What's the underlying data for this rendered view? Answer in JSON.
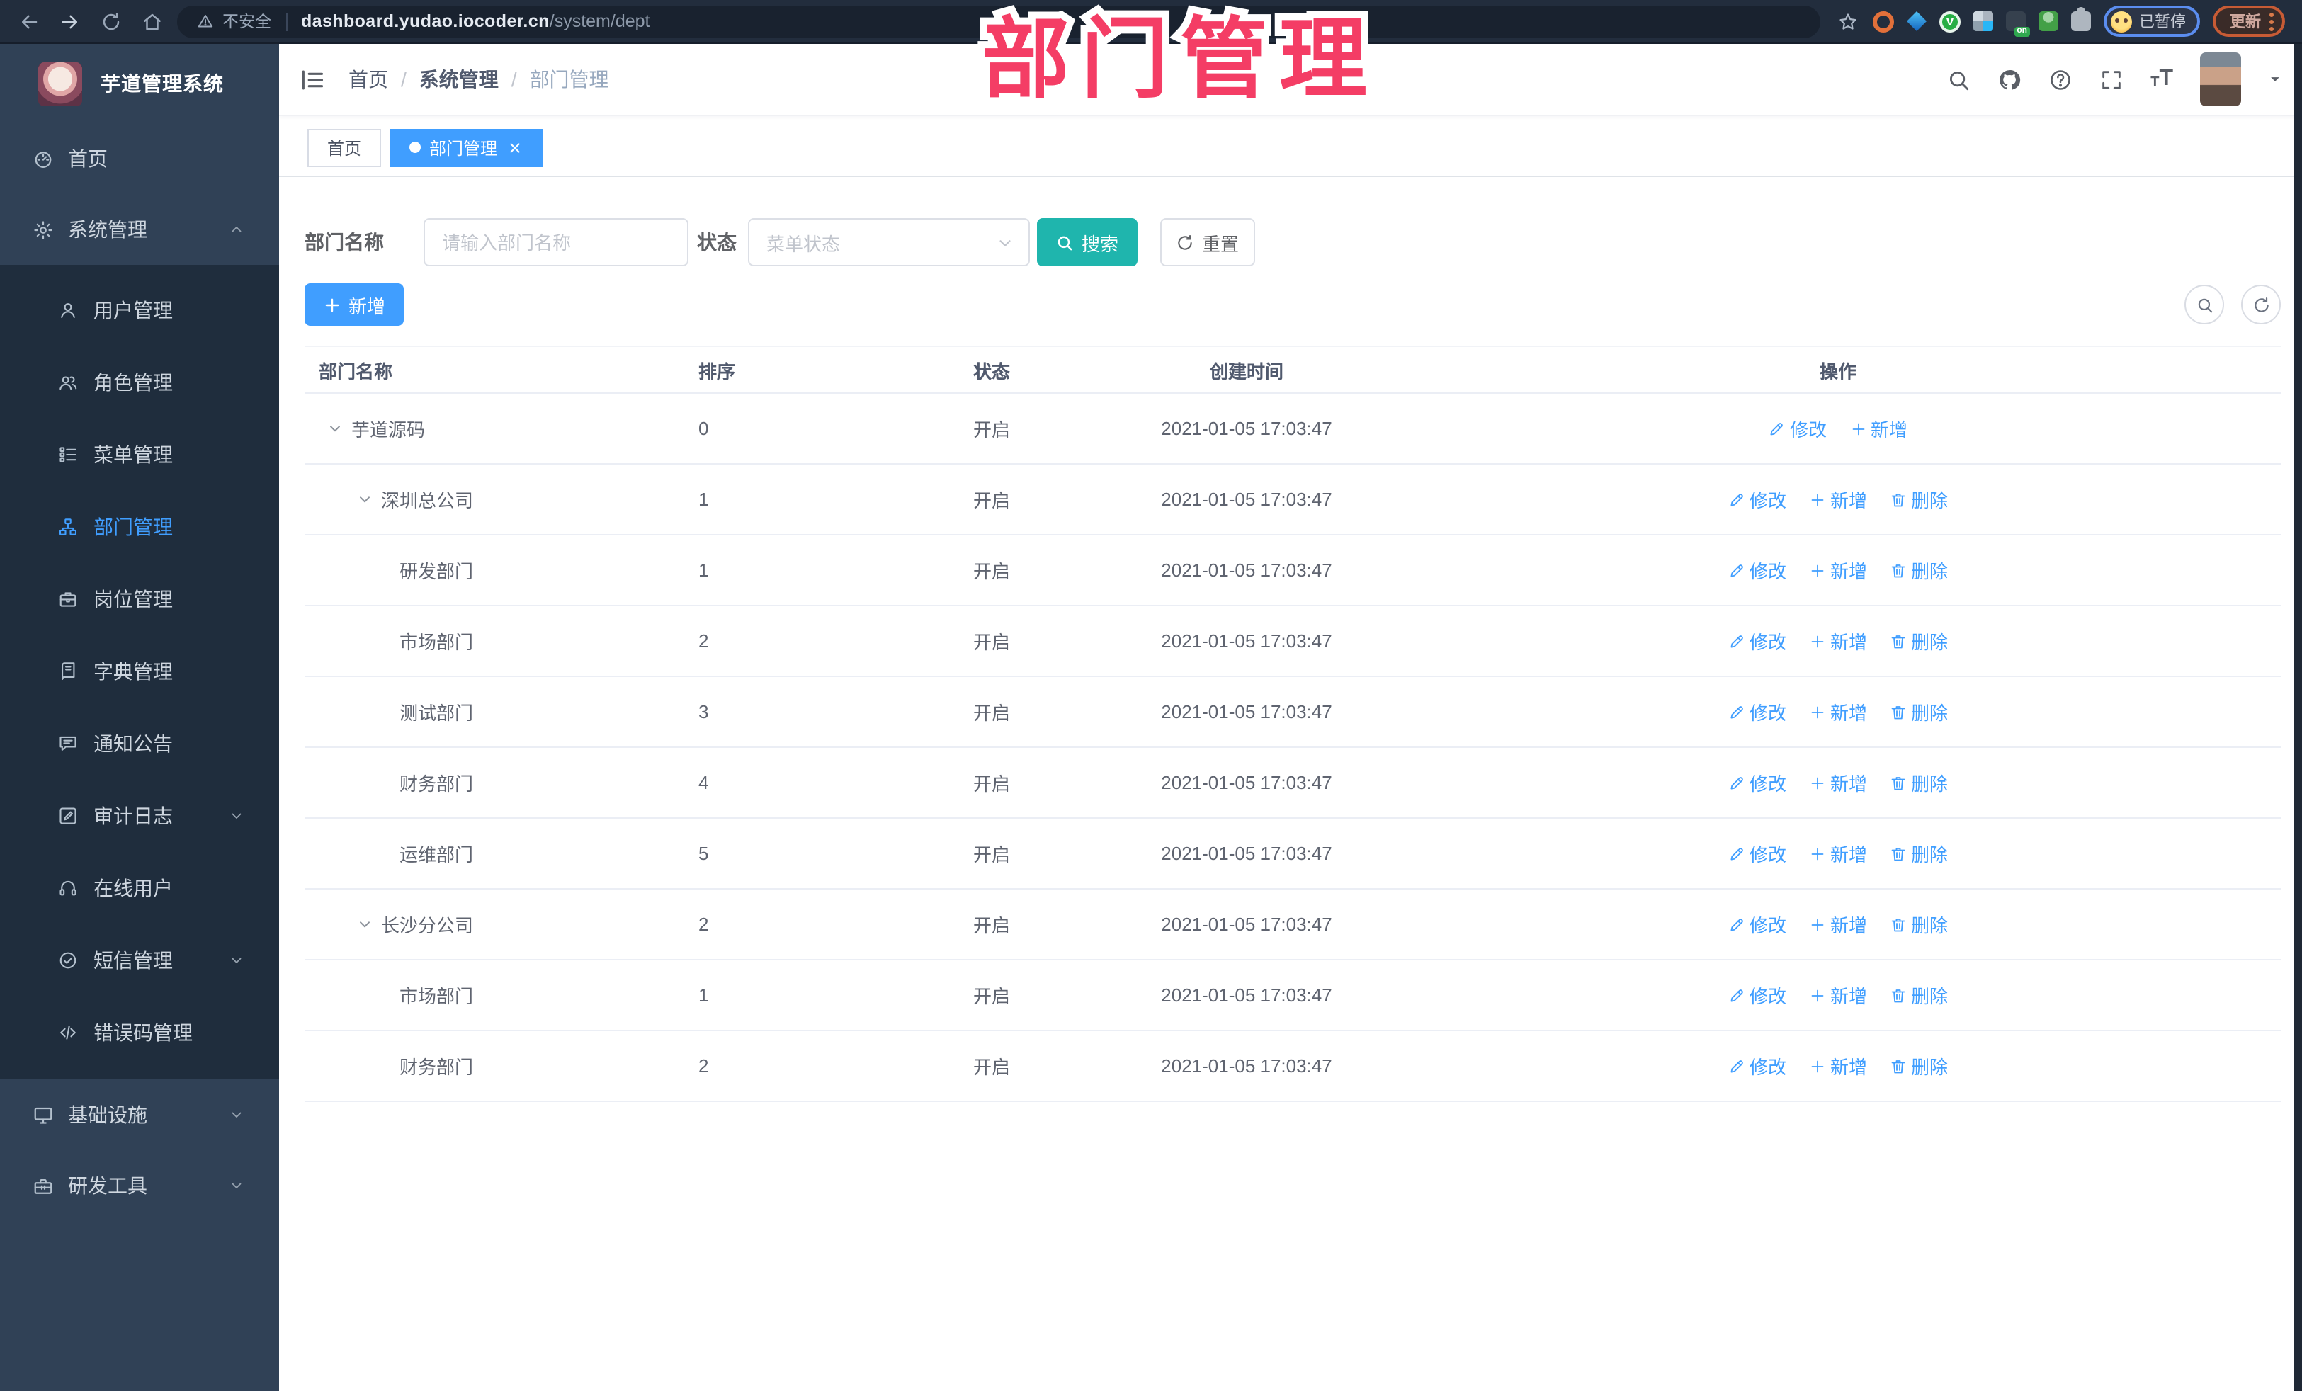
{
  "colors": {
    "accent": "#409EFF",
    "sidebar_bg": "#304156",
    "submenu_bg": "#1f2d3d",
    "search_button": "#1FB5AD",
    "overlay_pink": "#F43D65",
    "toolbar_bg": "#222d3d"
  },
  "browser": {
    "security_label": "不安全",
    "url_host": "dashboard.yudao.iocoder.cn",
    "url_path": "/system/dept",
    "profile_status": "已暂停",
    "update_label": "更新",
    "nav_icons": [
      "back-icon",
      "forward-icon",
      "reload-icon",
      "home-icon"
    ],
    "extension_icons": [
      "bookmark-star-icon",
      "ext-orange-icon",
      "ext-blue-icon",
      "ext-green-icon",
      "ext-grid-icon",
      "ext-onoff-icon",
      "ext-person-icon",
      "extensions-puzzle-icon"
    ]
  },
  "overlay": {
    "title": "部门管理"
  },
  "sidebar": {
    "logo_title": "芋道管理系统",
    "items": [
      {
        "key": "home",
        "label": "首页",
        "icon": "dashboard-icon",
        "level": 0
      },
      {
        "key": "system",
        "label": "系统管理",
        "icon": "gear-icon",
        "level": 0,
        "chevron": "up",
        "expanded": true
      },
      {
        "key": "user",
        "label": "用户管理",
        "icon": "user-icon",
        "level": 1
      },
      {
        "key": "role",
        "label": "角色管理",
        "icon": "roles-icon",
        "level": 1
      },
      {
        "key": "menu",
        "label": "菜单管理",
        "icon": "menu-tree-icon",
        "level": 1
      },
      {
        "key": "dept",
        "label": "部门管理",
        "icon": "org-chart-icon",
        "level": 1,
        "active": true
      },
      {
        "key": "post",
        "label": "岗位管理",
        "icon": "post-badge-icon",
        "level": 1
      },
      {
        "key": "dict",
        "label": "字典管理",
        "icon": "dictionary-icon",
        "level": 1
      },
      {
        "key": "notice",
        "label": "通知公告",
        "icon": "announcement-icon",
        "level": 1
      },
      {
        "key": "audit-log",
        "label": "审计日志",
        "icon": "audit-log-icon",
        "level": 1,
        "chevron": "down"
      },
      {
        "key": "online-user",
        "label": "在线用户",
        "icon": "online-users-icon",
        "level": 1
      },
      {
        "key": "sms",
        "label": "短信管理",
        "icon": "sms-icon",
        "level": 1,
        "chevron": "down"
      },
      {
        "key": "error-code",
        "label": "错误码管理",
        "icon": "error-code-icon",
        "level": 1
      },
      {
        "key": "infra",
        "label": "基础设施",
        "icon": "infrastructure-icon",
        "level": 0,
        "chevron": "down"
      },
      {
        "key": "dev-tools",
        "label": "研发工具",
        "icon": "dev-tools-icon",
        "level": 0,
        "chevron": "down"
      }
    ]
  },
  "header": {
    "breadcrumb": [
      "首页",
      "系统管理",
      "部门管理"
    ],
    "right_icons": [
      "search-icon",
      "github-icon",
      "help-icon",
      "fullscreen-icon",
      "font-size-icon",
      "avatar",
      "caret-down-icon"
    ]
  },
  "tabs": [
    {
      "label": "首页",
      "active": false
    },
    {
      "label": "部门管理",
      "active": true,
      "closable": true
    }
  ],
  "filters": {
    "name_label": "部门名称",
    "name_placeholder": "请输入部门名称",
    "name_value": "",
    "status_label": "状态",
    "status_placeholder": "菜单状态",
    "search_label": "搜索",
    "reset_label": "重置"
  },
  "toolbar": {
    "add_label": "新增"
  },
  "table": {
    "columns": [
      "部门名称",
      "排序",
      "状态",
      "创建时间",
      "操作"
    ],
    "action_defs": {
      "edit": {
        "label": "修改",
        "icon": "edit-icon"
      },
      "add": {
        "label": "新增",
        "icon": "plus-icon"
      },
      "delete": {
        "label": "删除",
        "icon": "delete-icon"
      }
    },
    "rows": [
      {
        "name": "芋道源码",
        "level": 0,
        "expandable": true,
        "order": "0",
        "status": "开启",
        "created": "2021-01-05 17:03:47",
        "actions": [
          "edit",
          "add"
        ]
      },
      {
        "name": "深圳总公司",
        "level": 1,
        "expandable": true,
        "order": "1",
        "status": "开启",
        "created": "2021-01-05 17:03:47",
        "actions": [
          "edit",
          "add",
          "delete"
        ]
      },
      {
        "name": "研发部门",
        "level": 2,
        "expandable": false,
        "order": "1",
        "status": "开启",
        "created": "2021-01-05 17:03:47",
        "actions": [
          "edit",
          "add",
          "delete"
        ]
      },
      {
        "name": "市场部门",
        "level": 2,
        "expandable": false,
        "order": "2",
        "status": "开启",
        "created": "2021-01-05 17:03:47",
        "actions": [
          "edit",
          "add",
          "delete"
        ]
      },
      {
        "name": "测试部门",
        "level": 2,
        "expandable": false,
        "order": "3",
        "status": "开启",
        "created": "2021-01-05 17:03:47",
        "actions": [
          "edit",
          "add",
          "delete"
        ]
      },
      {
        "name": "财务部门",
        "level": 2,
        "expandable": false,
        "order": "4",
        "status": "开启",
        "created": "2021-01-05 17:03:47",
        "actions": [
          "edit",
          "add",
          "delete"
        ]
      },
      {
        "name": "运维部门",
        "level": 2,
        "expandable": false,
        "order": "5",
        "status": "开启",
        "created": "2021-01-05 17:03:47",
        "actions": [
          "edit",
          "add",
          "delete"
        ]
      },
      {
        "name": "长沙分公司",
        "level": 1,
        "expandable": true,
        "order": "2",
        "status": "开启",
        "created": "2021-01-05 17:03:47",
        "actions": [
          "edit",
          "add",
          "delete"
        ]
      },
      {
        "name": "市场部门",
        "level": 2,
        "expandable": false,
        "order": "1",
        "status": "开启",
        "created": "2021-01-05 17:03:47",
        "actions": [
          "edit",
          "add",
          "delete"
        ]
      },
      {
        "name": "财务部门",
        "level": 2,
        "expandable": false,
        "order": "2",
        "status": "开启",
        "created": "2021-01-05 17:03:47",
        "actions": [
          "edit",
          "add",
          "delete"
        ]
      }
    ]
  }
}
